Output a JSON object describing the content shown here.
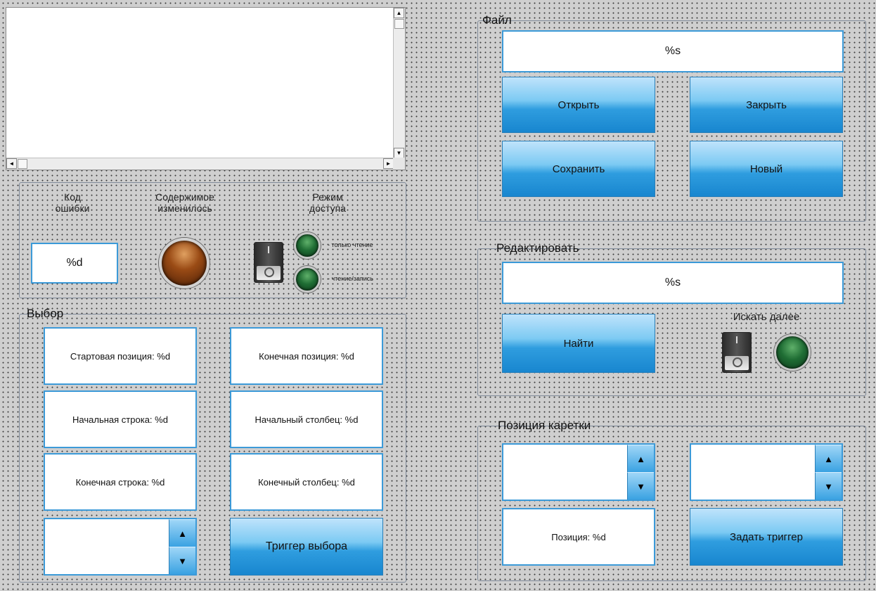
{
  "editor": {
    "scroll_up": "▲",
    "scroll_down": "▼",
    "scroll_left": "◄",
    "scroll_right": "►"
  },
  "status": {
    "error_code_label": "Код ошибки",
    "error_code_value": "%d",
    "content_changed_label": "Содержимое изменилось",
    "access_mode_label": "Режим доступа",
    "readonly_label": "- только чтение",
    "readwrite_label": "- чтение/запись"
  },
  "selection": {
    "title": "Выбор",
    "start_position": "Стартовая позиция: %d",
    "end_position": "Конечная позиция: %d",
    "start_line": "Начальная строка: %d",
    "start_column": "Начальный столбец: %d",
    "end_line": "Конечная строка: %d",
    "end_column": "Конечный столбец: %d",
    "spin_value": "",
    "trigger_button": "Триггер выбора"
  },
  "file": {
    "title": "Файл",
    "path_value": "%s",
    "open_button": "Открыть",
    "close_button": "Закрыть",
    "save_button": "Сохранить",
    "new_button": "Новый"
  },
  "edit": {
    "title": "Редактировать",
    "search_value": "%s",
    "find_button": "Найти",
    "find_next_label": "Искать далее"
  },
  "caret": {
    "title": "Позиция каретки",
    "spin1_value": "",
    "spin2_value": "",
    "position_label": "Позиция: %d",
    "set_trigger_button": "Задать триггер"
  },
  "icons": {
    "spin_up": "▲",
    "spin_down": "▼"
  },
  "colors": {
    "field_border": "#3c9ad8",
    "button_gradient_bottom": "#1886cf",
    "led_green": "#1f6d34",
    "led_amber": "#9a4b15"
  }
}
